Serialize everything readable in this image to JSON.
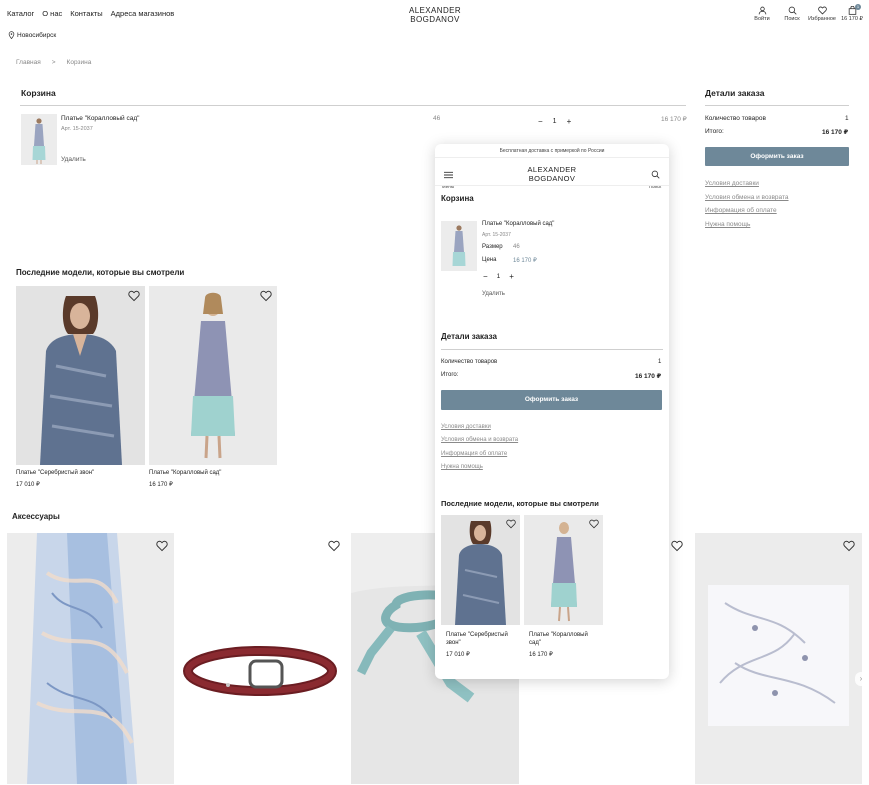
{
  "header": {
    "nav": [
      "Каталог",
      "О нас",
      "Контакты",
      "Адреса магазинов"
    ],
    "logo_line1": "ALEXANDER",
    "logo_line2": "BOGDANOV",
    "actions": {
      "login": "Войти",
      "search": "Поиск",
      "favorites": "Избранное",
      "cart": "16 170 ₽",
      "cart_count": "1"
    },
    "city": "Новосибирск"
  },
  "breadcrumb": {
    "home": "Главная",
    "separator": ">",
    "current": "Корзина"
  },
  "cart": {
    "title": "Корзина",
    "item": {
      "name": "Платье \"Коралловый сад\"",
      "article": "Арт. 15-2037",
      "size": "46",
      "qty": "1",
      "minus": "−",
      "plus": "+",
      "price": "16 170 ₽",
      "remove": "Удалить"
    }
  },
  "order": {
    "title": "Детали заказа",
    "count_label": "Количество товаров",
    "count_value": "1",
    "total_label": "Итого:",
    "total_value": "16 170 ₽",
    "checkout": "Оформить заказ",
    "links": [
      "Условия доставки",
      "Условия обмена и возврата",
      "Информация об оплате",
      "Нужна помощь"
    ]
  },
  "recent": {
    "title": "Последние модели, которые вы смотрели",
    "items": [
      {
        "name": "Платье \"Серебристый звон\"",
        "price": "17 010 ₽"
      },
      {
        "name": "Платье \"Коралловый сад\"",
        "price": "16 170 ₽"
      }
    ]
  },
  "accessories": {
    "title": "Аксессуары"
  },
  "mobile": {
    "banner": "Бесплатная доставка с примеркой по России",
    "menu_label": "Меню",
    "search_label": "Поиск",
    "logo_line1": "ALEXANDER",
    "logo_line2": "BOGDANOV",
    "cart_title": "Корзина",
    "item_name": "Платье \"Коралловый сад\"",
    "item_article": "Арт. 15-2037",
    "size_label": "Размер",
    "size_value": "46",
    "price_label": "Цена",
    "price_value": "16 170 ₽",
    "qty": "1",
    "minus": "−",
    "plus": "+",
    "remove": "Удалить",
    "order_title": "Детали заказа",
    "count_label": "Количество товаров",
    "count_value": "1",
    "total_label": "Итого:",
    "total_value": "16 170 ₽",
    "checkout": "Оформить заказ",
    "links": [
      "Условия доставки",
      "Условия обмена и возврата",
      "Информация об оплате",
      "Нужна помощь"
    ],
    "recent_title": "Последние модели, которые вы смотрели",
    "recent": [
      {
        "name_line1": "Платье \"Серебристый",
        "name_line2": "звон\"",
        "price": "17 010 ₽"
      },
      {
        "name_line1": "Платье \"Коралловый",
        "name_line2": "сад\"",
        "price": "16 170 ₽"
      }
    ]
  },
  "colors": {
    "accent": "#6e8899",
    "text": "#222222",
    "muted": "#8a8a8a"
  }
}
